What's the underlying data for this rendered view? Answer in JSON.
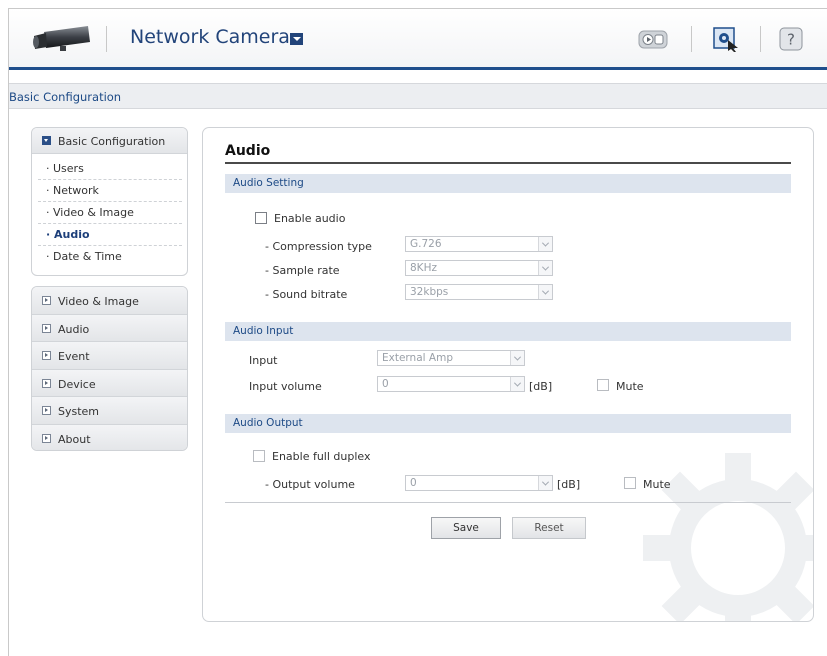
{
  "header": {
    "app_title": "Network Camera"
  },
  "breadcrumb": "Basic Configuration",
  "sidebar": {
    "open_group": {
      "label": "Basic Configuration",
      "items": [
        {
          "label": "Users",
          "active": false
        },
        {
          "label": "Network",
          "active": false
        },
        {
          "label": "Video & Image",
          "active": false
        },
        {
          "label": "Audio",
          "active": true
        },
        {
          "label": "Date & Time",
          "active": false
        }
      ]
    },
    "groups": [
      {
        "label": "Video & Image"
      },
      {
        "label": "Audio"
      },
      {
        "label": "Event"
      },
      {
        "label": "Device"
      },
      {
        "label": "System"
      },
      {
        "label": "About"
      }
    ]
  },
  "main": {
    "title": "Audio",
    "audio_setting": {
      "heading": "Audio Setting",
      "enable_label": "Enable audio",
      "enable_checked": false,
      "compression_label": "- Compression type",
      "compression_value": "G.726",
      "sample_rate_label": "- Sample rate",
      "sample_rate_value": "8KHz",
      "bitrate_label": "- Sound bitrate",
      "bitrate_value": "32kbps"
    },
    "audio_input": {
      "heading": "Audio Input",
      "input_label": "Input",
      "input_value": "External Amp",
      "volume_label": "Input volume",
      "volume_value": "0",
      "unit": "[dB]",
      "mute_label": "Mute"
    },
    "audio_output": {
      "heading": "Audio Output",
      "duplex_label": "Enable full duplex",
      "volume_label": "- Output volume",
      "volume_value": "0",
      "unit": "[dB]",
      "mute_label": "Mute"
    },
    "buttons": {
      "save": "Save",
      "reset": "Reset"
    }
  },
  "icons": {
    "logo": "camera-logo-icon",
    "title_dropdown": "chevron-down-icon",
    "view": "live-view-icon",
    "setup": "setup-icon",
    "help": "help-icon"
  },
  "colors": {
    "brand_blue": "#1f4e8c",
    "section_bar": "#dde4ee"
  }
}
